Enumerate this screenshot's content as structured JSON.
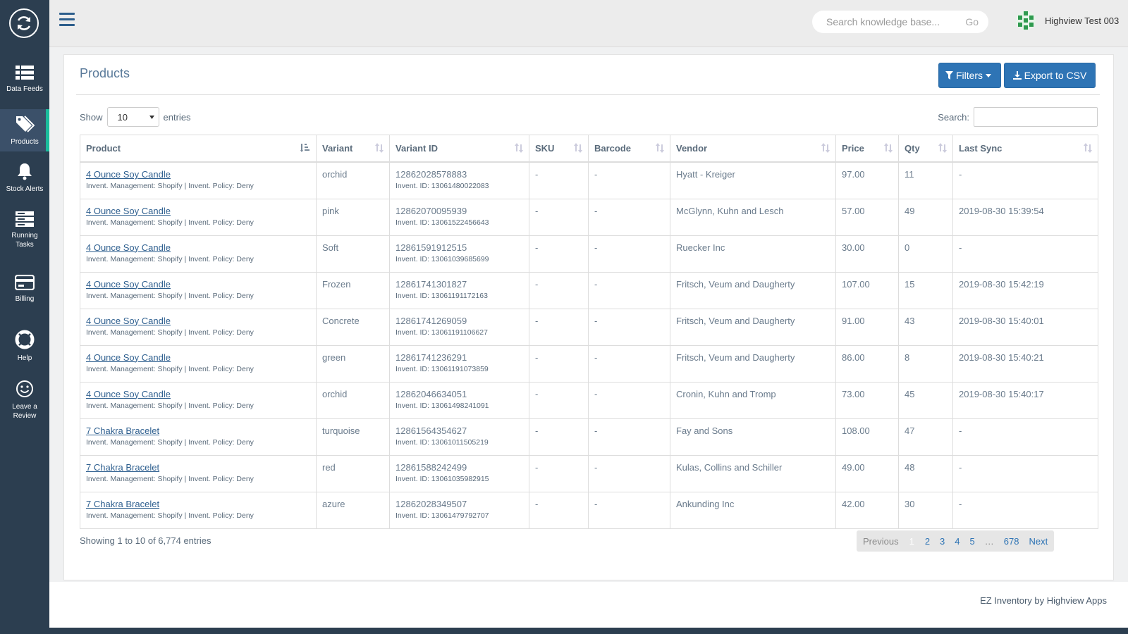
{
  "sidebar": {
    "items": [
      {
        "label": "Data Feeds",
        "icon": "list-icon"
      },
      {
        "label": "Products",
        "icon": "tags-icon"
      },
      {
        "label": "Stock Alerts",
        "icon": "bell-icon"
      },
      {
        "label": "Running Tasks",
        "icon": "server-icon"
      },
      {
        "label": "Billing",
        "icon": "credit-card-icon"
      },
      {
        "label": "Help",
        "icon": "life-ring-icon"
      },
      {
        "label": "Leave a Review",
        "icon": "smile-icon"
      }
    ]
  },
  "header": {
    "search_placeholder": "Search knowledge base...",
    "go_label": "Go",
    "user_name": "Highview Test 003"
  },
  "panel": {
    "title": "Products",
    "filters_label": "Filters",
    "export_label": "Export to CSV",
    "show_label": "Show",
    "entries_label": "entries",
    "page_size": "10",
    "search_label": "Search:"
  },
  "table": {
    "columns": [
      "Product",
      "Variant",
      "Variant ID",
      "SKU",
      "Barcode",
      "Vendor",
      "Price",
      "Qty",
      "Last Sync"
    ],
    "rows": [
      {
        "product": "4 Ounce Soy Candle",
        "meta": "Invent. Management: Shopify | Invent. Policy: Deny",
        "variant": "orchid",
        "variant_id": "12862028578883",
        "invent_id": "Invent. ID: 13061480022083",
        "sku": "-",
        "barcode": "-",
        "vendor": "Hyatt - Kreiger",
        "price": "97.00",
        "qty": "11",
        "last_sync": "-"
      },
      {
        "product": "4 Ounce Soy Candle",
        "meta": "Invent. Management: Shopify | Invent. Policy: Deny",
        "variant": "pink",
        "variant_id": "12862070095939",
        "invent_id": "Invent. ID: 13061522456643",
        "sku": "-",
        "barcode": "-",
        "vendor": "McGlynn, Kuhn and Lesch",
        "price": "57.00",
        "qty": "49",
        "last_sync": "2019-08-30 15:39:54"
      },
      {
        "product": "4 Ounce Soy Candle",
        "meta": "Invent. Management: Shopify | Invent. Policy: Deny",
        "variant": "Soft",
        "variant_id": "12861591912515",
        "invent_id": "Invent. ID: 13061039685699",
        "sku": "-",
        "barcode": "-",
        "vendor": "Ruecker Inc",
        "price": "30.00",
        "qty": "0",
        "last_sync": "-"
      },
      {
        "product": "4 Ounce Soy Candle",
        "meta": "Invent. Management: Shopify | Invent. Policy: Deny",
        "variant": "Frozen",
        "variant_id": "12861741301827",
        "invent_id": "Invent. ID: 13061191172163",
        "sku": "-",
        "barcode": "-",
        "vendor": "Fritsch, Veum and Daugherty",
        "price": "107.00",
        "qty": "15",
        "last_sync": "2019-08-30 15:42:19"
      },
      {
        "product": "4 Ounce Soy Candle",
        "meta": "Invent. Management: Shopify | Invent. Policy: Deny",
        "variant": "Concrete",
        "variant_id": "12861741269059",
        "invent_id": "Invent. ID: 13061191106627",
        "sku": "-",
        "barcode": "-",
        "vendor": "Fritsch, Veum and Daugherty",
        "price": "91.00",
        "qty": "43",
        "last_sync": "2019-08-30 15:40:01"
      },
      {
        "product": "4 Ounce Soy Candle",
        "meta": "Invent. Management: Shopify | Invent. Policy: Deny",
        "variant": "green",
        "variant_id": "12861741236291",
        "invent_id": "Invent. ID: 13061191073859",
        "sku": "-",
        "barcode": "-",
        "vendor": "Fritsch, Veum and Daugherty",
        "price": "86.00",
        "qty": "8",
        "last_sync": "2019-08-30 15:40:21"
      },
      {
        "product": "4 Ounce Soy Candle",
        "meta": "Invent. Management: Shopify | Invent. Policy: Deny",
        "variant": "orchid",
        "variant_id": "12862046634051",
        "invent_id": "Invent. ID: 13061498241091",
        "sku": "-",
        "barcode": "-",
        "vendor": "Cronin, Kuhn and Tromp",
        "price": "73.00",
        "qty": "45",
        "last_sync": "2019-08-30 15:40:17"
      },
      {
        "product": "7 Chakra Bracelet",
        "meta": "Invent. Management: Shopify | Invent. Policy: Deny",
        "variant": "turquoise",
        "variant_id": "12861564354627",
        "invent_id": "Invent. ID: 13061011505219",
        "sku": "-",
        "barcode": "-",
        "vendor": "Fay and Sons",
        "price": "108.00",
        "qty": "47",
        "last_sync": "-"
      },
      {
        "product": "7 Chakra Bracelet",
        "meta": "Invent. Management: Shopify | Invent. Policy: Deny",
        "variant": "red",
        "variant_id": "12861588242499",
        "invent_id": "Invent. ID: 13061035982915",
        "sku": "-",
        "barcode": "-",
        "vendor": "Kulas, Collins and Schiller",
        "price": "49.00",
        "qty": "48",
        "last_sync": "-"
      },
      {
        "product": "7 Chakra Bracelet",
        "meta": "Invent. Management: Shopify | Invent. Policy: Deny",
        "variant": "azure",
        "variant_id": "12862028349507",
        "invent_id": "Invent. ID: 13061479792707",
        "sku": "-",
        "barcode": "-",
        "vendor": "Ankunding Inc",
        "price": "42.00",
        "qty": "30",
        "last_sync": "-"
      }
    ]
  },
  "footer": {
    "showing": "Showing 1 to 10 of 6,774 entries",
    "pager": {
      "previous": "Previous",
      "pages": [
        "1",
        "2",
        "3",
        "4",
        "5"
      ],
      "ellipsis": "…",
      "last": "678",
      "next": "Next",
      "current": "1"
    },
    "credit": "EZ Inventory by Highview Apps"
  },
  "colors": {
    "sidebar": "#2c3e50",
    "active_indicator": "#1abc9c",
    "primary": "#2e74b5"
  }
}
